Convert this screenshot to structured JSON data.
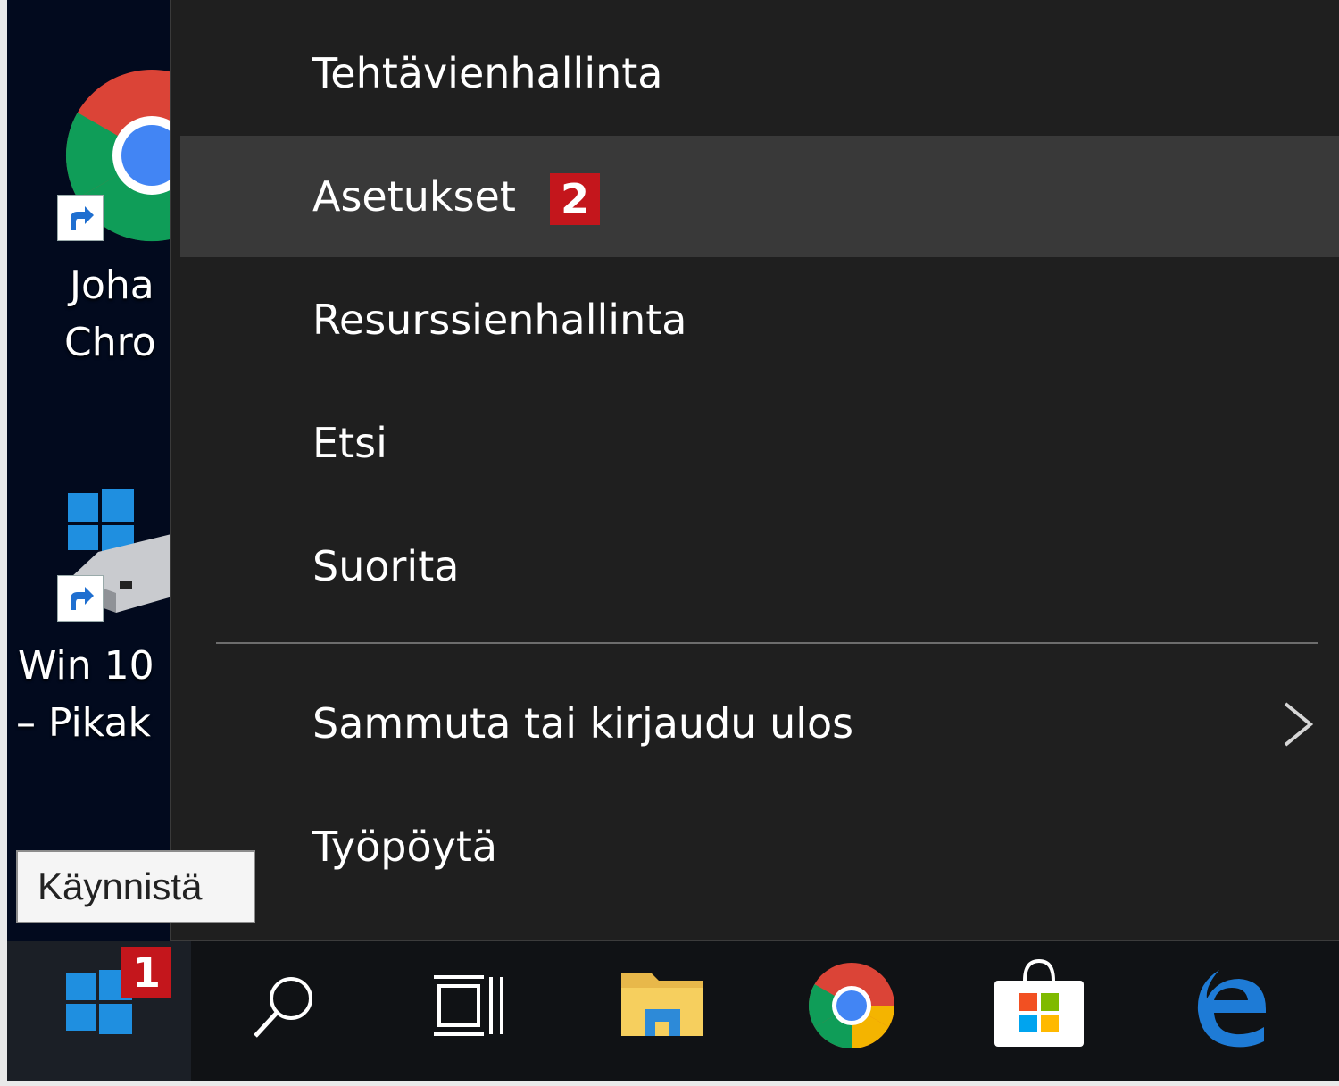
{
  "desktop": {
    "icons": [
      {
        "label_line1": "Joha",
        "label_line2": "Chro",
        "icon": "chrome-shortcut-icon"
      },
      {
        "label_line1": "Win 10",
        "label_line2": "– Pikak",
        "icon": "windows-drive-shortcut-icon"
      }
    ]
  },
  "menu": {
    "items": [
      {
        "label": "Tehtävienhallinta"
      },
      {
        "label": "Asetukset",
        "badge": "2"
      },
      {
        "label": "Resurssienhallinta"
      },
      {
        "label": "Etsi"
      },
      {
        "label": "Suorita"
      },
      {
        "label": "Sammuta tai kirjaudu ulos",
        "has_submenu": true
      },
      {
        "label": "Työpöytä"
      }
    ],
    "highlighted_index": 1
  },
  "tooltip": {
    "text": "Käynnistä"
  },
  "taskbar": {
    "start_badge": "1",
    "icons": [
      "windows-start-icon",
      "search-icon",
      "task-view-icon",
      "file-explorer-icon",
      "chrome-icon",
      "store-icon",
      "edge-icon"
    ]
  },
  "colors": {
    "menu_bg": "#1f1f1f",
    "menu_hover": "#393939",
    "badge_red": "#c4161c",
    "windows_blue": "#1f8fe0",
    "desktop_bg": "#020a1e"
  }
}
